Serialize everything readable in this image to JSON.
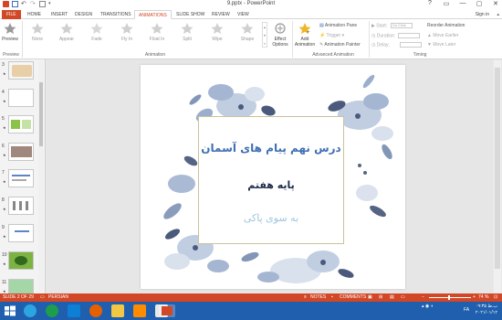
{
  "window": {
    "title": "9.pptx - PowerPoint",
    "controls": [
      "?",
      "▭",
      "—",
      "▢",
      "✕"
    ]
  },
  "tabs": {
    "file": "FILE",
    "items": [
      "HOME",
      "INSERT",
      "DESIGN",
      "TRANSITIONS",
      "ANIMATIONS",
      "SLIDE SHOW",
      "REVIEW",
      "VIEW"
    ],
    "active": "ANIMATIONS",
    "sign_in": "Sign in"
  },
  "ribbon": {
    "preview": {
      "label": "Preview",
      "group": "Preview"
    },
    "animations": [
      "None",
      "Appear",
      "Fade",
      "Fly In",
      "Float In",
      "Split",
      "Wipe",
      "Shape"
    ],
    "effect_options": "Effect Options",
    "group_animation": "Animation",
    "add_animation": "Add Animation",
    "animation_pane": "Animation Pane",
    "trigger": "Trigger",
    "animation_painter": "Animation Painter",
    "group_advanced": "Advanced Animation",
    "start_label": "Start:",
    "start_value": "On Click",
    "duration_label": "Duration:",
    "delay_label": "Delay:",
    "group_timing": "Timing",
    "reorder_title": "Reorder Animation",
    "move_earlier": "Move Earlier",
    "move_later": "Move Later"
  },
  "thumbnails": [
    {
      "number": "3",
      "marked": true
    },
    {
      "number": "4",
      "marked": true
    },
    {
      "number": "5",
      "marked": true
    },
    {
      "number": "6",
      "marked": true
    },
    {
      "number": "7",
      "marked": true
    },
    {
      "number": "8",
      "marked": true
    },
    {
      "number": "9",
      "marked": true
    },
    {
      "number": "10",
      "marked": true
    },
    {
      "number": "11",
      "marked": true
    }
  ],
  "slide": {
    "line1": "درس نهم پیام های آسمان",
    "line2": "پایه هفتم",
    "line3": "به سوی پاکی"
  },
  "status": {
    "slide_info": "SLIDE 2 OF 29",
    "language": "PERSIAN",
    "notes": "NOTES",
    "comments": "COMMENTS",
    "zoom": "74 %"
  },
  "taskbar": {
    "time": "۰۹:۳۵ ب.ظ",
    "date": "۲۰۲۱/۰۱/۱۲",
    "lang": "FA"
  },
  "colors": {
    "accent": "#d24726",
    "taskbar": "#1f5fae",
    "title_text": "#3f6fb5",
    "subtitle_text": "#1e2a4a",
    "tagline_text": "#9fc6e0"
  }
}
